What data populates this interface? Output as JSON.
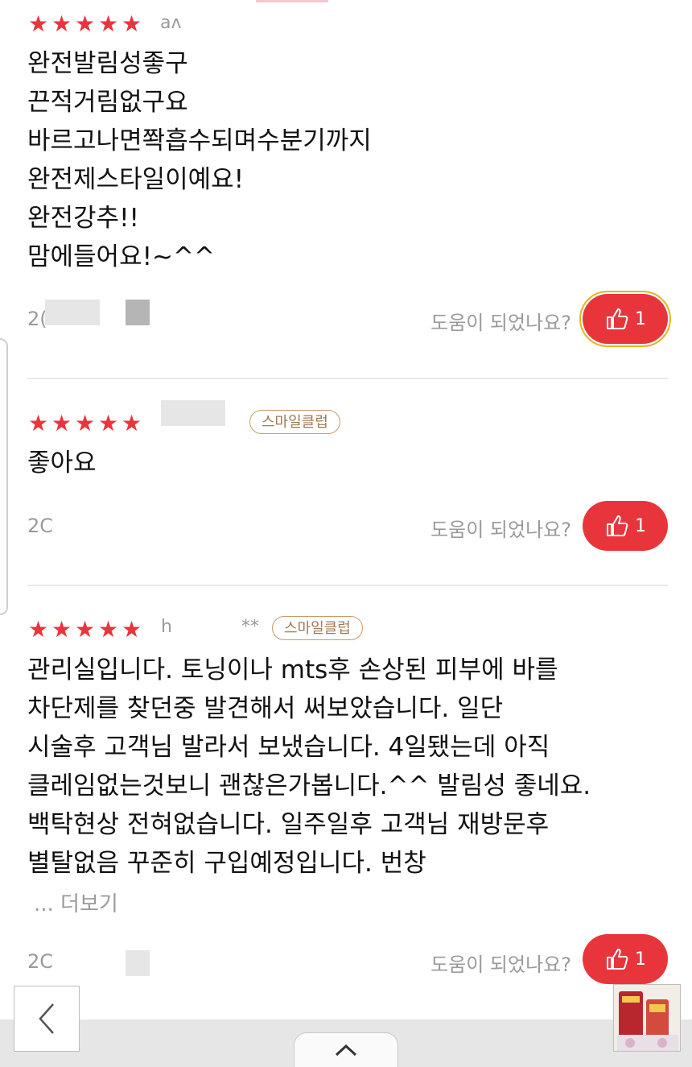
{
  "colors": {
    "accent": "#e8353c",
    "muted": "#9a9a9a",
    "badge": "#a07a55"
  },
  "icons": {
    "star": "star-icon",
    "like": "thumbs-up-icon",
    "back": "chevron-left-icon",
    "up": "chevron-up-icon"
  },
  "reviews": [
    {
      "stars": "★★★★★",
      "author": "aʌ",
      "badge": "",
      "text": "완전발림성좋구\n끈적거림없구요\n바르고나면쫙흡수되며수분기까지\n완전제스타일이예요!\n완전강추!!\n맘에들어요!~^^",
      "more": "",
      "date": "2(",
      "helpful_question": "도움이 되었나요?",
      "like_count": "1"
    },
    {
      "stars": "★★★★★",
      "author": "",
      "badge": "스마일클럽",
      "text": "좋아요",
      "more": "",
      "date": "2C",
      "helpful_question": "도움이 되었나요?",
      "like_count": "1"
    },
    {
      "stars": "★★★★★",
      "author": "h",
      "author_suffix": "**",
      "badge": "스마일클럽",
      "text": "관리실입니다. 토닝이나 mts후 손상된 피부에 바를\n차단제를 찾던중 발견해서 써보았습니다. 일단\n시술후 고객님 발라서 보냈습니다. 4일됐는데 아직\n클레임없는것보니 괜찮은가봅니다.^^ 발림성 좋네요.\n백탁현상 전혀없습니다. 일주일후 고객님 재방문후\n별탈없음 꾸준히 구입예정입니다. 번창",
      "more": "... 더보기",
      "date": "2C",
      "helpful_question": "도움이 되었나요?",
      "like_count": "1"
    }
  ]
}
